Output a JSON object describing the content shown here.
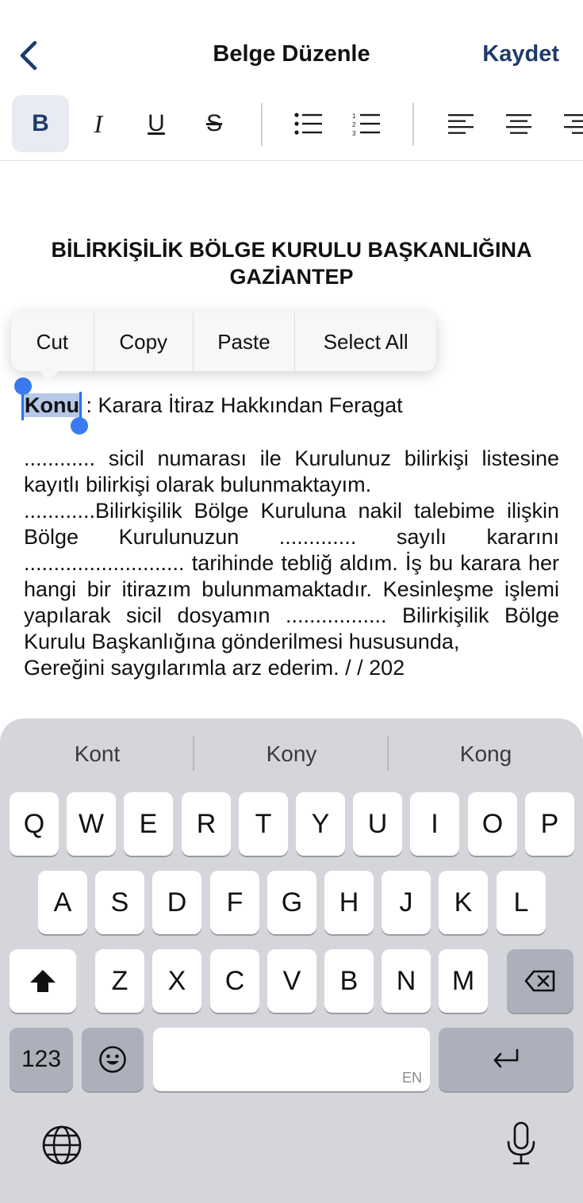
{
  "header": {
    "back_icon": "chevron-left-icon",
    "title": "Belge Düzenle",
    "save_label": "Kaydet",
    "accent_color": "#1f3a6b"
  },
  "toolbar": {
    "bold": "B",
    "italic": "I",
    "underline": "U",
    "strikethrough": "S",
    "active": "bold",
    "icons": [
      "bullet-list-icon",
      "numbered-list-icon",
      "align-left-icon",
      "align-center-icon",
      "align-right-icon"
    ]
  },
  "document": {
    "heading_line1": "BİLİRKİŞİLİK BÖLGE KURULU BAŞKANLIĞINA",
    "heading_line2": "GAZİANTEP",
    "subject_key": "Konu",
    "subject_value": " : Karara İtiraz Hakkından Feragat",
    "para1": "............ sicil numarası ile Kurulunuz bilirkişi listesine kayıtlı bilirkişi olarak bulunmaktayım.",
    "para2": "............Bilirkişilik Bölge Kuruluna nakil talebime ilişkin Bölge Kurulunuzun ............. sayılı kararını ........................... tarihinde tebliğ aldım. İş bu karara her hangi bir itirazım bulunmamaktadır. Kesinleşme işlemi yapılarak sicil dosyamın ................. Bilirkişilik Bölge Kurulu Başkanlığına gönderilmesi hususunda,",
    "para3": " Gereğini saygılarımla arz ederim.      /      / 202"
  },
  "context_menu": {
    "cut": "Cut",
    "copy": "Copy",
    "paste": "Paste",
    "select_all": "Select All"
  },
  "keyboard": {
    "suggestions": [
      "Kont",
      "Kony",
      "Kong"
    ],
    "row1": [
      "Q",
      "W",
      "E",
      "R",
      "T",
      "Y",
      "U",
      "I",
      "O",
      "P"
    ],
    "row2": [
      "A",
      "S",
      "D",
      "F",
      "G",
      "H",
      "J",
      "K",
      "L"
    ],
    "row3": [
      "Z",
      "X",
      "C",
      "V",
      "B",
      "N",
      "M"
    ],
    "numbers_label": "123",
    "space_lang": "EN",
    "icons": [
      "shift-icon",
      "backspace-icon",
      "emoji-icon",
      "return-icon",
      "globe-icon",
      "microphone-icon"
    ]
  }
}
